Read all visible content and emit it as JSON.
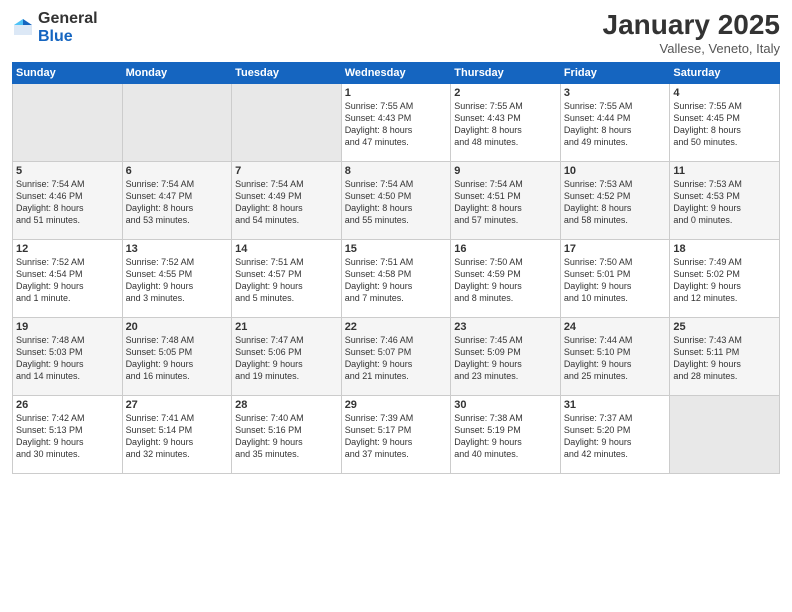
{
  "header": {
    "logo_general": "General",
    "logo_blue": "Blue",
    "month_title": "January 2025",
    "subtitle": "Vallese, Veneto, Italy"
  },
  "weekdays": [
    "Sunday",
    "Monday",
    "Tuesday",
    "Wednesday",
    "Thursday",
    "Friday",
    "Saturday"
  ],
  "weeks": [
    [
      {
        "day": "",
        "text": ""
      },
      {
        "day": "",
        "text": ""
      },
      {
        "day": "",
        "text": ""
      },
      {
        "day": "1",
        "text": "Sunrise: 7:55 AM\nSunset: 4:43 PM\nDaylight: 8 hours\nand 47 minutes."
      },
      {
        "day": "2",
        "text": "Sunrise: 7:55 AM\nSunset: 4:43 PM\nDaylight: 8 hours\nand 48 minutes."
      },
      {
        "day": "3",
        "text": "Sunrise: 7:55 AM\nSunset: 4:44 PM\nDaylight: 8 hours\nand 49 minutes."
      },
      {
        "day": "4",
        "text": "Sunrise: 7:55 AM\nSunset: 4:45 PM\nDaylight: 8 hours\nand 50 minutes."
      }
    ],
    [
      {
        "day": "5",
        "text": "Sunrise: 7:54 AM\nSunset: 4:46 PM\nDaylight: 8 hours\nand 51 minutes."
      },
      {
        "day": "6",
        "text": "Sunrise: 7:54 AM\nSunset: 4:47 PM\nDaylight: 8 hours\nand 53 minutes."
      },
      {
        "day": "7",
        "text": "Sunrise: 7:54 AM\nSunset: 4:49 PM\nDaylight: 8 hours\nand 54 minutes."
      },
      {
        "day": "8",
        "text": "Sunrise: 7:54 AM\nSunset: 4:50 PM\nDaylight: 8 hours\nand 55 minutes."
      },
      {
        "day": "9",
        "text": "Sunrise: 7:54 AM\nSunset: 4:51 PM\nDaylight: 8 hours\nand 57 minutes."
      },
      {
        "day": "10",
        "text": "Sunrise: 7:53 AM\nSunset: 4:52 PM\nDaylight: 8 hours\nand 58 minutes."
      },
      {
        "day": "11",
        "text": "Sunrise: 7:53 AM\nSunset: 4:53 PM\nDaylight: 9 hours\nand 0 minutes."
      }
    ],
    [
      {
        "day": "12",
        "text": "Sunrise: 7:52 AM\nSunset: 4:54 PM\nDaylight: 9 hours\nand 1 minute."
      },
      {
        "day": "13",
        "text": "Sunrise: 7:52 AM\nSunset: 4:55 PM\nDaylight: 9 hours\nand 3 minutes."
      },
      {
        "day": "14",
        "text": "Sunrise: 7:51 AM\nSunset: 4:57 PM\nDaylight: 9 hours\nand 5 minutes."
      },
      {
        "day": "15",
        "text": "Sunrise: 7:51 AM\nSunset: 4:58 PM\nDaylight: 9 hours\nand 7 minutes."
      },
      {
        "day": "16",
        "text": "Sunrise: 7:50 AM\nSunset: 4:59 PM\nDaylight: 9 hours\nand 8 minutes."
      },
      {
        "day": "17",
        "text": "Sunrise: 7:50 AM\nSunset: 5:01 PM\nDaylight: 9 hours\nand 10 minutes."
      },
      {
        "day": "18",
        "text": "Sunrise: 7:49 AM\nSunset: 5:02 PM\nDaylight: 9 hours\nand 12 minutes."
      }
    ],
    [
      {
        "day": "19",
        "text": "Sunrise: 7:48 AM\nSunset: 5:03 PM\nDaylight: 9 hours\nand 14 minutes."
      },
      {
        "day": "20",
        "text": "Sunrise: 7:48 AM\nSunset: 5:05 PM\nDaylight: 9 hours\nand 16 minutes."
      },
      {
        "day": "21",
        "text": "Sunrise: 7:47 AM\nSunset: 5:06 PM\nDaylight: 9 hours\nand 19 minutes."
      },
      {
        "day": "22",
        "text": "Sunrise: 7:46 AM\nSunset: 5:07 PM\nDaylight: 9 hours\nand 21 minutes."
      },
      {
        "day": "23",
        "text": "Sunrise: 7:45 AM\nSunset: 5:09 PM\nDaylight: 9 hours\nand 23 minutes."
      },
      {
        "day": "24",
        "text": "Sunrise: 7:44 AM\nSunset: 5:10 PM\nDaylight: 9 hours\nand 25 minutes."
      },
      {
        "day": "25",
        "text": "Sunrise: 7:43 AM\nSunset: 5:11 PM\nDaylight: 9 hours\nand 28 minutes."
      }
    ],
    [
      {
        "day": "26",
        "text": "Sunrise: 7:42 AM\nSunset: 5:13 PM\nDaylight: 9 hours\nand 30 minutes."
      },
      {
        "day": "27",
        "text": "Sunrise: 7:41 AM\nSunset: 5:14 PM\nDaylight: 9 hours\nand 32 minutes."
      },
      {
        "day": "28",
        "text": "Sunrise: 7:40 AM\nSunset: 5:16 PM\nDaylight: 9 hours\nand 35 minutes."
      },
      {
        "day": "29",
        "text": "Sunrise: 7:39 AM\nSunset: 5:17 PM\nDaylight: 9 hours\nand 37 minutes."
      },
      {
        "day": "30",
        "text": "Sunrise: 7:38 AM\nSunset: 5:19 PM\nDaylight: 9 hours\nand 40 minutes."
      },
      {
        "day": "31",
        "text": "Sunrise: 7:37 AM\nSunset: 5:20 PM\nDaylight: 9 hours\nand 42 minutes."
      },
      {
        "day": "",
        "text": ""
      }
    ]
  ]
}
